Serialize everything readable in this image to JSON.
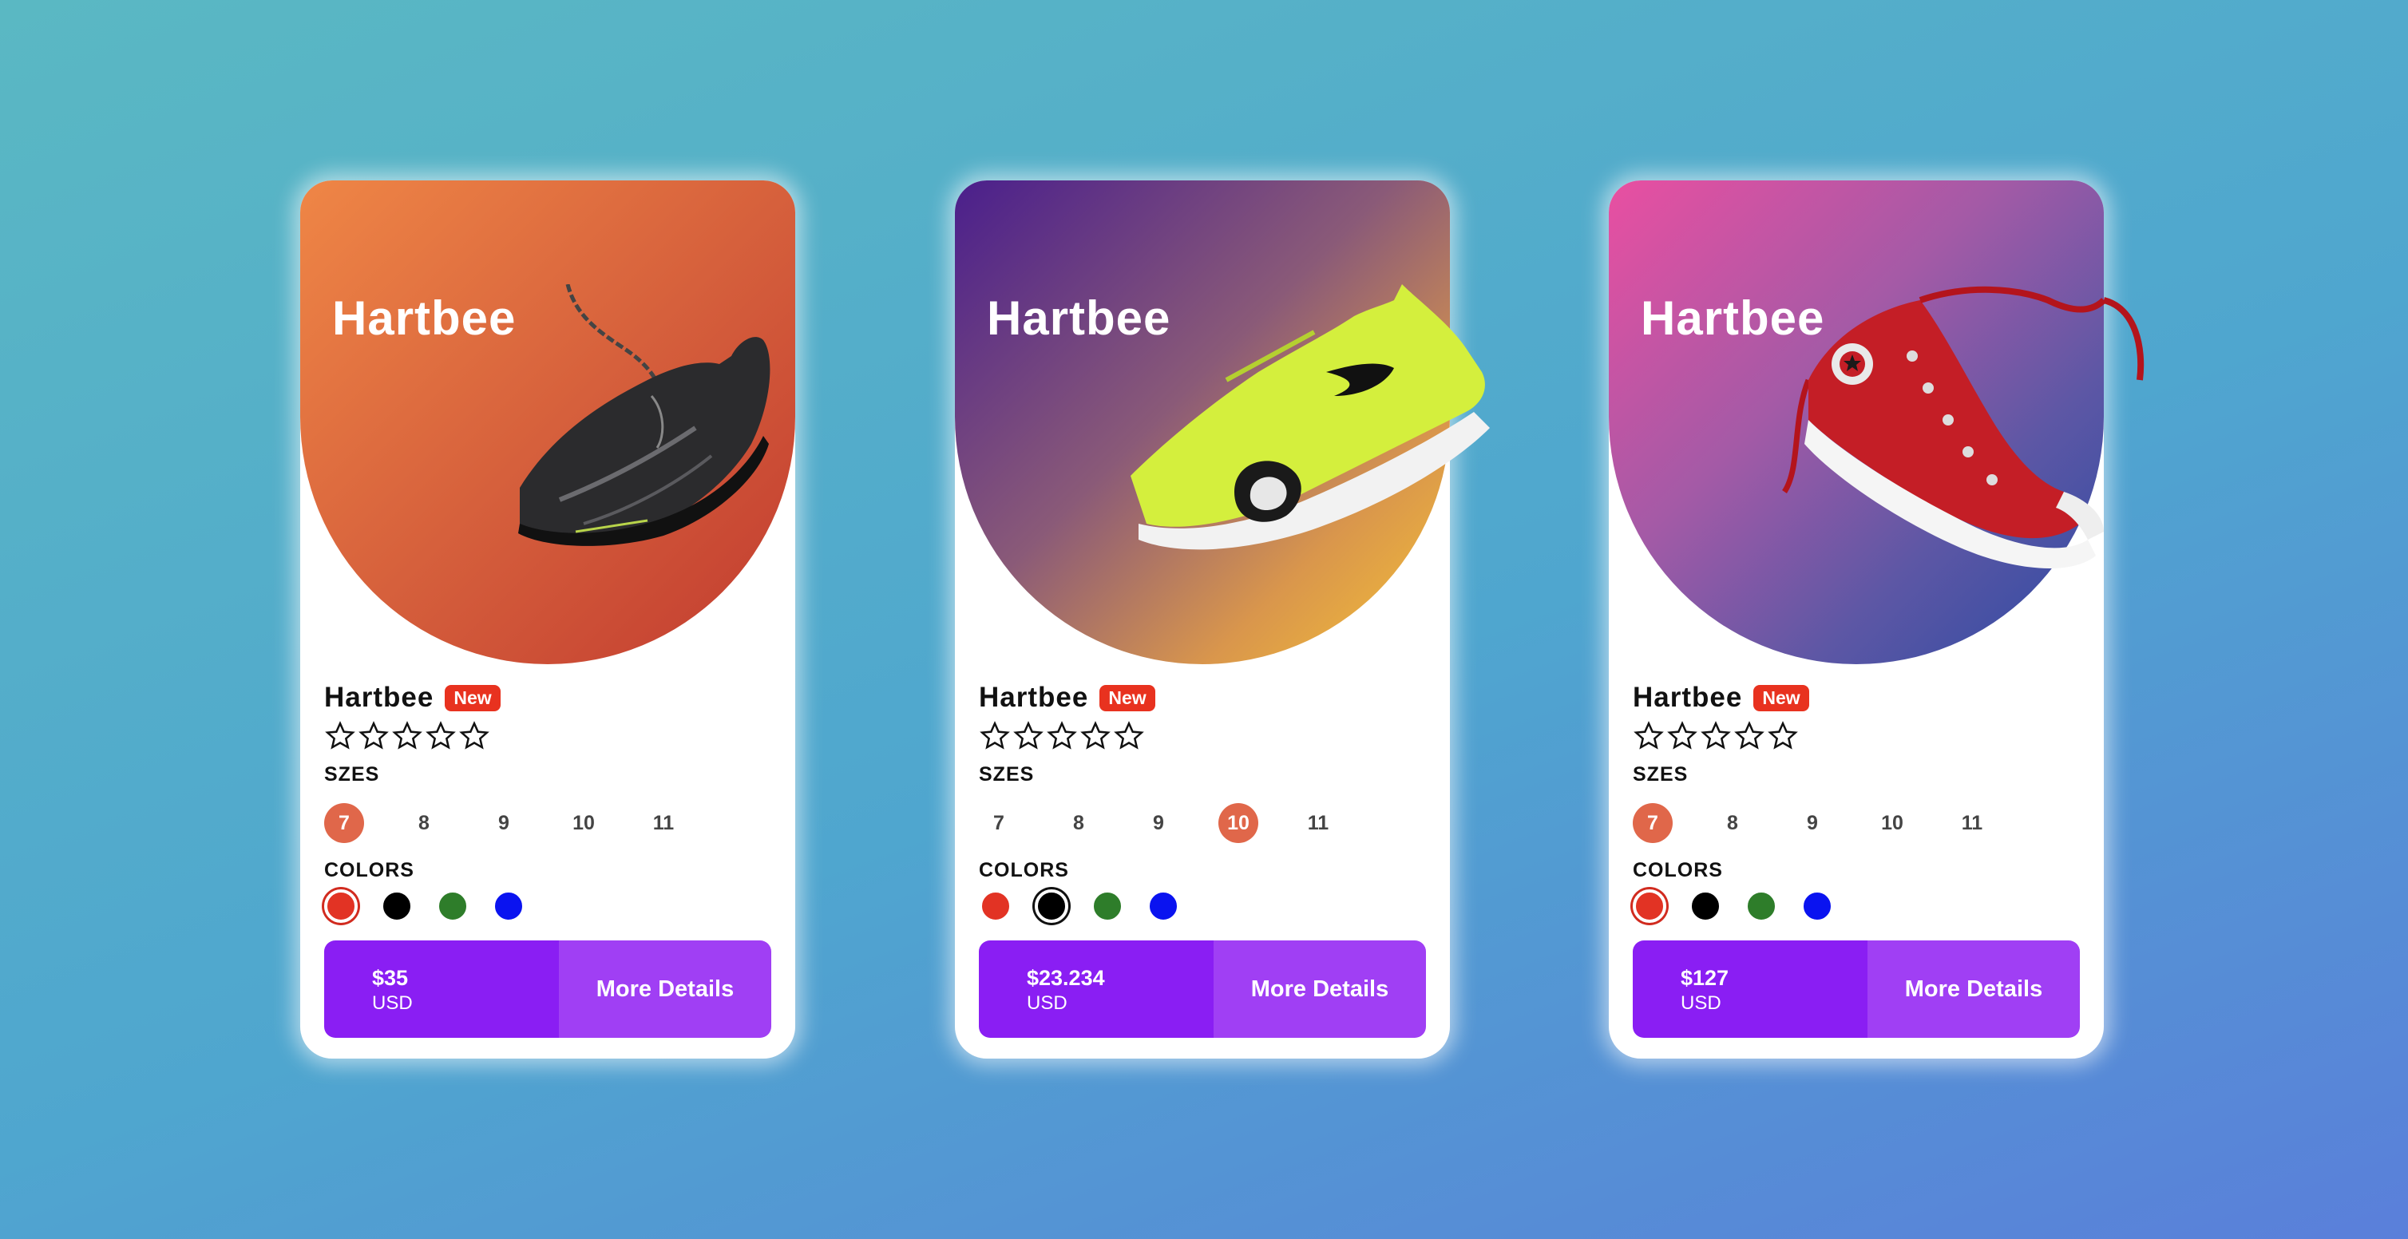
{
  "cards": [
    {
      "brand": "Hartbee",
      "name": "Hartbee",
      "badge": "New",
      "sizes_label": "SZES",
      "sizes": [
        "7",
        "8",
        "9",
        "10",
        "11"
      ],
      "selected_size": "7",
      "colors_label": "COLORS",
      "colors": [
        "#e23324",
        "#000000",
        "#2e7d2a",
        "#0a13f0"
      ],
      "selected_color": "#e23324",
      "price": "$35",
      "currency": "USD",
      "details_label": "More Details",
      "shoe": "black-running-shoe"
    },
    {
      "brand": "Hartbee",
      "name": "Hartbee",
      "badge": "New",
      "sizes_label": "SZES",
      "sizes": [
        "7",
        "8",
        "9",
        "10",
        "11"
      ],
      "selected_size": "10",
      "colors_label": "COLORS",
      "colors": [
        "#e23324",
        "#000000",
        "#2e7d2a",
        "#0a13f0"
      ],
      "selected_color": "#000000",
      "price": "$23.234",
      "currency": "USD",
      "details_label": "More Details",
      "shoe": "neon-green-trainer"
    },
    {
      "brand": "Hartbee",
      "name": "Hartbee",
      "badge": "New",
      "sizes_label": "SZES",
      "sizes": [
        "7",
        "8",
        "9",
        "10",
        "11"
      ],
      "selected_size": "7",
      "colors_label": "COLORS",
      "colors": [
        "#e23324",
        "#000000",
        "#2e7d2a",
        "#0a13f0"
      ],
      "selected_color": "#e23324",
      "price": "$127",
      "currency": "USD",
      "details_label": "More Details",
      "shoe": "red-high-top-sneaker"
    }
  ],
  "rating_stars": 5
}
